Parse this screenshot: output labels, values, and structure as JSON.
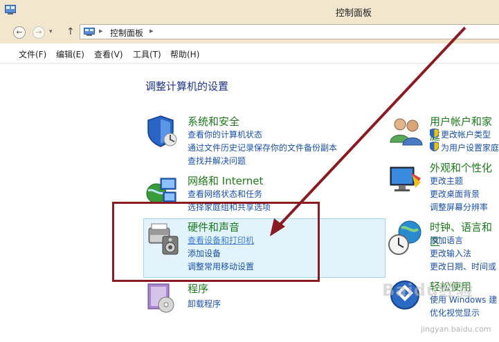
{
  "window": {
    "title": "控制面板"
  },
  "address": {
    "crumb": "控制面板"
  },
  "menu": [
    "文件(F)",
    "编辑(E)",
    "查看(V)",
    "工具(T)",
    "帮助(H)"
  ],
  "page_title": "调整计算机的设置",
  "left": [
    {
      "title": "系统和安全",
      "links": [
        "查看你的计算机状态",
        "通过文件历史记录保存你的文件备份副本",
        "查找并解决问题"
      ]
    },
    {
      "title": "网络和 Internet",
      "links": [
        "查看网络状态和任务",
        "选择家庭组和共享选项"
      ]
    },
    {
      "title": "硬件和声音",
      "links": [
        "查看设备和打印机",
        "添加设备",
        "调整常用移动设置"
      ]
    },
    {
      "title": "程序",
      "links": [
        "卸载程序"
      ]
    }
  ],
  "right": [
    {
      "title": "用户帐户和家庭",
      "links": [
        "更改帐户类型",
        "为用户设置家庭"
      ]
    },
    {
      "title": "外观和个性化",
      "links": [
        "更改主题",
        "更改桌面背景",
        "调整屏幕分辨率"
      ]
    },
    {
      "title": "时钟、语言和区",
      "links": [
        "添加语言",
        "更改输入法",
        "更改日期、时间或"
      ]
    },
    {
      "title": "轻松使用",
      "links": [
        "使用 Windows 建",
        "优化视觉显示"
      ]
    }
  ],
  "watermark": {
    "main": "Baidu经验",
    "sub": "jingyan.baidu.com"
  },
  "colors": {
    "annotation": "#8a1b20",
    "chrome": "#f2e6ce",
    "link": "#1b50a8",
    "category": "#1c7a1c"
  }
}
